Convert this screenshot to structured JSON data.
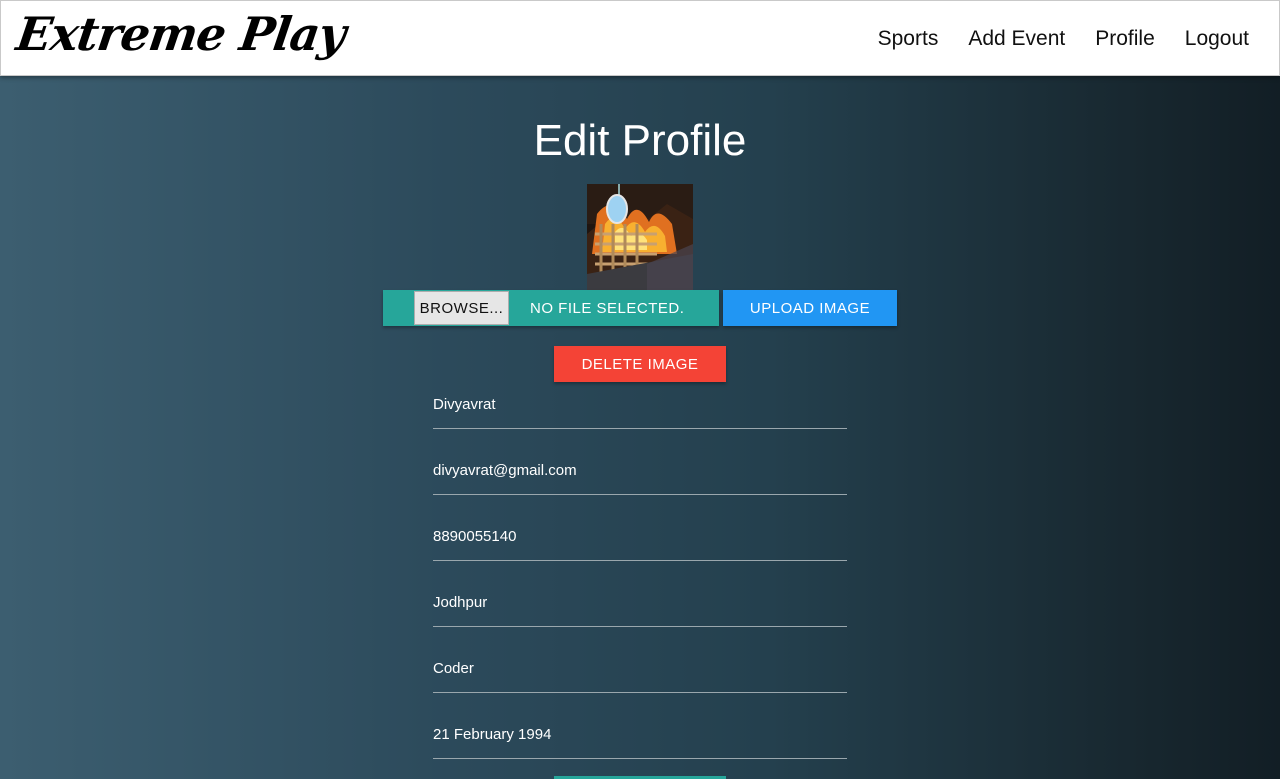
{
  "brand": {
    "name": "Extreme Play"
  },
  "nav": {
    "items": [
      {
        "label": "Sports"
      },
      {
        "label": "Add Event"
      },
      {
        "label": "Profile"
      },
      {
        "label": "Logout"
      }
    ]
  },
  "page": {
    "title": "Edit Profile"
  },
  "upload": {
    "browse_label": "BROWSE...",
    "file_status": "NO FILE SELECTED.",
    "upload_label": "UPLOAD IMAGE",
    "delete_label": "DELETE IMAGE"
  },
  "form": {
    "fields": [
      {
        "name": "name",
        "value": "Divyavrat"
      },
      {
        "name": "email",
        "value": "divyavrat@gmail.com"
      },
      {
        "name": "phone",
        "value": "8890055140"
      },
      {
        "name": "city",
        "value": "Jodhpur"
      },
      {
        "name": "occupation",
        "value": "Coder"
      },
      {
        "name": "dob",
        "value": "21 February 1994"
      }
    ]
  },
  "colors": {
    "upload_teal": "#26a69a",
    "upload_blue": "#2196f3",
    "delete_red": "#f44336"
  }
}
